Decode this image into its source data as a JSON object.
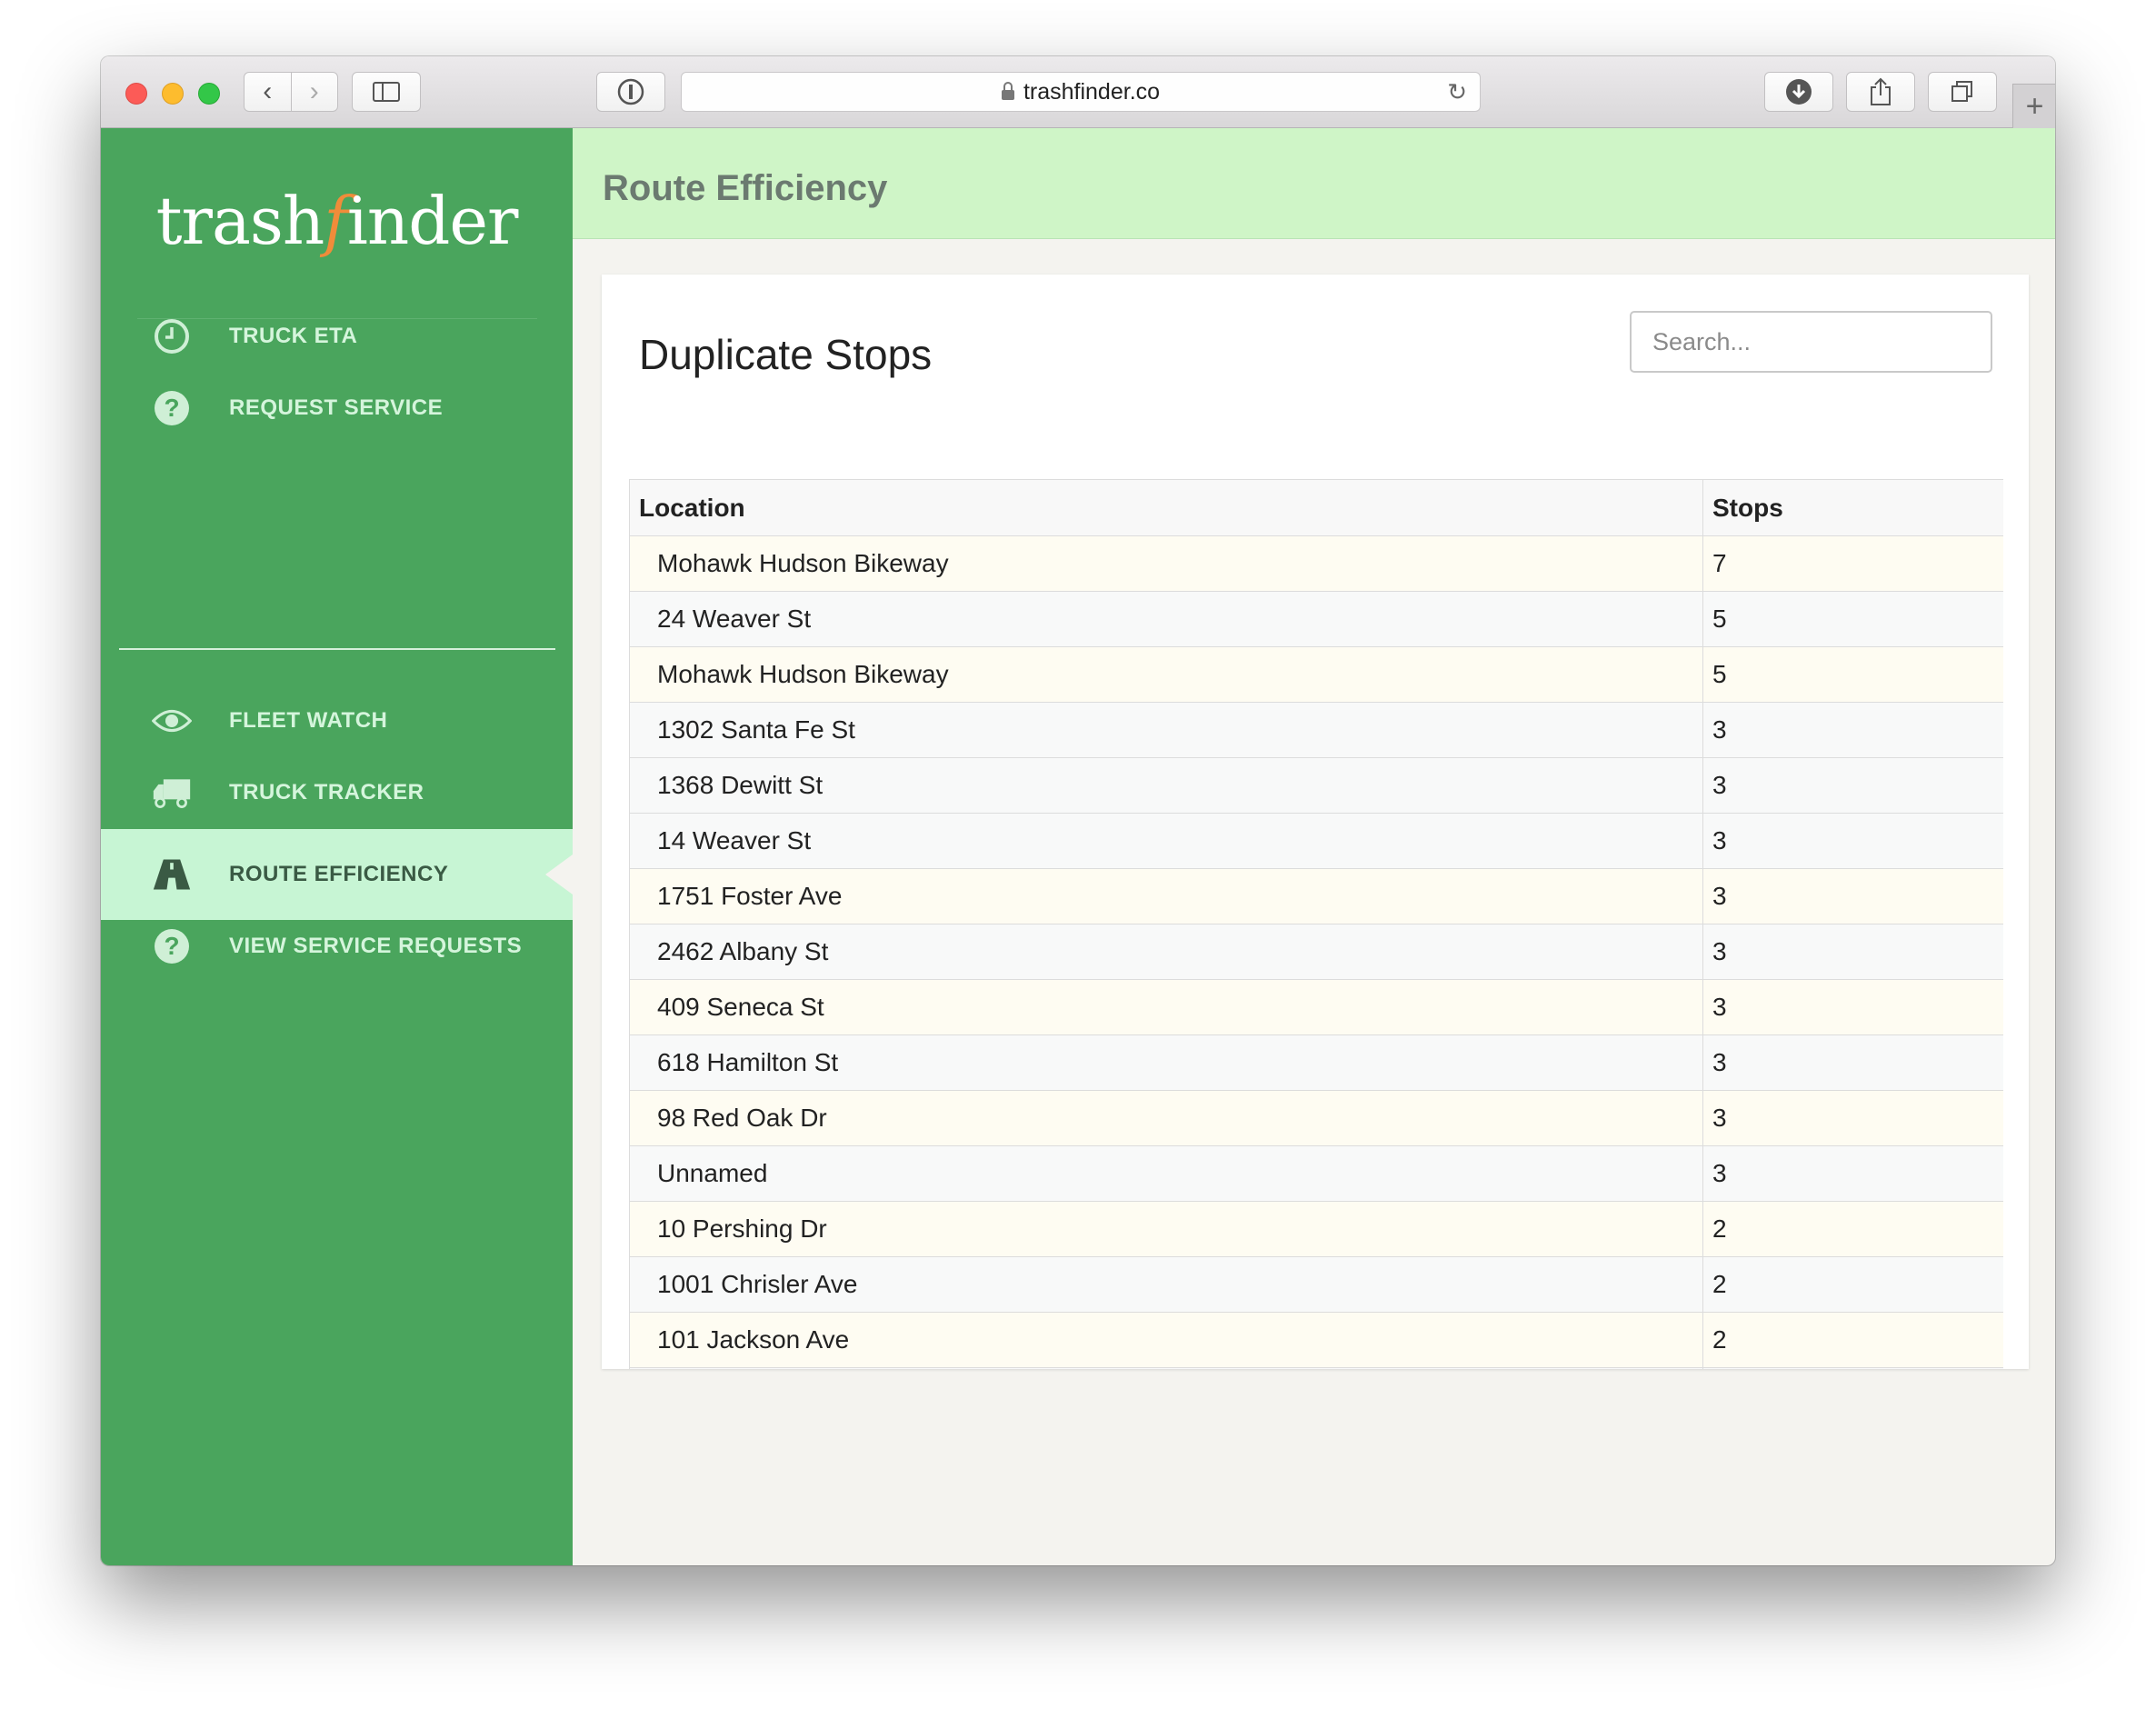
{
  "browser": {
    "url": "trashfinder.co"
  },
  "logo": {
    "part1": "trash",
    "part2": "f",
    "part3": "inder"
  },
  "sidebar": {
    "items": [
      {
        "label": "TRUCK ETA",
        "icon": "clock-icon"
      },
      {
        "label": "REQUEST SERVICE",
        "icon": "question-icon"
      },
      {
        "label": "FLEET WATCH",
        "icon": "eye-icon"
      },
      {
        "label": "TRUCK TRACKER",
        "icon": "truck-icon"
      },
      {
        "label": "ROUTE EFFICIENCY",
        "icon": "road-icon",
        "active": true
      },
      {
        "label": "VIEW SERVICE REQUESTS",
        "icon": "question-icon"
      }
    ]
  },
  "header": {
    "title": "Route Efficiency"
  },
  "card": {
    "title": "Duplicate Stops",
    "search_placeholder": "Search..."
  },
  "table": {
    "columns": [
      "Location",
      "Stops"
    ],
    "rows": [
      [
        "Mohawk Hudson Bikeway",
        "7"
      ],
      [
        "24 Weaver St",
        "5"
      ],
      [
        "Mohawk Hudson Bikeway",
        "5"
      ],
      [
        "1302 Santa Fe St",
        "3"
      ],
      [
        "1368 Dewitt St",
        "3"
      ],
      [
        "14 Weaver St",
        "3"
      ],
      [
        "1751 Foster Ave",
        "3"
      ],
      [
        "2462 Albany St",
        "3"
      ],
      [
        "409 Seneca St",
        "3"
      ],
      [
        "618 Hamilton St",
        "3"
      ],
      [
        "98 Red Oak Dr",
        "3"
      ],
      [
        "Unnamed",
        "3"
      ],
      [
        "10 Pershing Dr",
        "2"
      ],
      [
        "1001 Chrisler Ave",
        "2"
      ],
      [
        "101 Jackson Ave",
        "2"
      ]
    ]
  },
  "colors": {
    "sidebar": "#4aa55d",
    "active_item": "#c7f5d4",
    "header": "#cff5c7",
    "logo_accent": "#f08c3a"
  }
}
